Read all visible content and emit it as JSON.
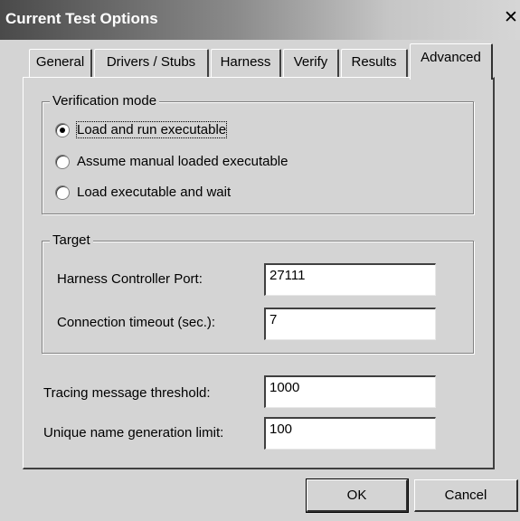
{
  "window": {
    "title": "Current Test Options",
    "close_glyph": "✕"
  },
  "tabs": [
    {
      "label": "General",
      "active": false
    },
    {
      "label": "Drivers / Stubs",
      "active": false
    },
    {
      "label": "Harness",
      "active": false
    },
    {
      "label": "Verify",
      "active": false
    },
    {
      "label": "Results",
      "active": false
    },
    {
      "label": "Advanced",
      "active": true
    }
  ],
  "verification_mode": {
    "title": "Verification mode",
    "options": [
      {
        "label": "Load and run executable",
        "selected": true
      },
      {
        "label": "Assume manual loaded executable",
        "selected": false
      },
      {
        "label": "Load executable and wait",
        "selected": false
      }
    ]
  },
  "target": {
    "title": "Target",
    "harness_port_label": "Harness Controller Port:",
    "harness_port_value": "27111",
    "timeout_label": "Connection timeout (sec.):",
    "timeout_value": "7"
  },
  "tracing": {
    "label": "Tracing message threshold:",
    "value": "1000"
  },
  "unique_name": {
    "label": "Unique name generation limit:",
    "value": "100"
  },
  "buttons": {
    "ok": "OK",
    "cancel": "Cancel"
  }
}
